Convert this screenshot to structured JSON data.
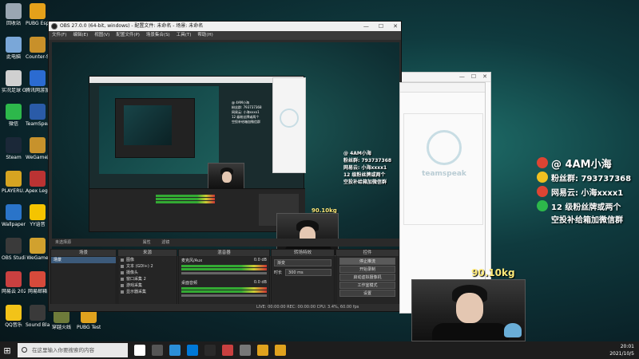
{
  "desktop": {
    "icons": [
      {
        "label": "回收站",
        "color": "#9aa6b2"
      },
      {
        "label": "此电脑",
        "color": "#7aa7d8"
      },
      {
        "label": "实况足球 Online 1",
        "color": "#d0d0d0"
      },
      {
        "label": "微信",
        "color": "#2db84b"
      },
      {
        "label": "Steam",
        "color": "#1b2838"
      },
      {
        "label": "PLAYERU... BATTLEGR...",
        "color": "#d6a421"
      },
      {
        "label": "Wallpaper Engine: ...",
        "color": "#2a74c9"
      },
      {
        "label": "OBS Studio",
        "color": "#3a3a3a"
      },
      {
        "label": "网易云 2021031...",
        "color": "#c94040"
      },
      {
        "label": "QQ音乐",
        "color": "#f2c318"
      },
      {
        "label": "PUBG Esport...",
        "color": "#e5a11a"
      },
      {
        "label": "Counter-S... Global Of...",
        "color": "#c8902a"
      },
      {
        "label": "腾讯网游加速器",
        "color": "#2b6bd1"
      },
      {
        "label": "TeamSpeak 3",
        "color": "#2a5ba8"
      },
      {
        "label": "WeGame版",
        "color": "#c7922c"
      },
      {
        "label": "Apex Legends",
        "color": "#b33"
      },
      {
        "label": "YY语音",
        "color": "#f5c400"
      },
      {
        "label": "WeGame",
        "color": "#d1a12e"
      },
      {
        "label": "网易邮箱",
        "color": "#d64a3b"
      },
      {
        "label": "Sound Blaster ...",
        "color": "#3a3a3a"
      }
    ],
    "second_column_bottom": [
      {
        "label": "穿越火线",
        "color": "#6e7b3a"
      },
      {
        "label": "PUBG Test Server",
        "color": "#e0a21e"
      }
    ]
  },
  "obs_window": {
    "title": "OBS 27.0.0 (64-bit, windows) - 配置文件: 未命名 - 场景: 未命名",
    "menu": [
      "文件(F)",
      "编辑(E)",
      "视图(V)",
      "配置文件(P)",
      "场景集合(S)",
      "工具(T)",
      "帮助(H)"
    ],
    "window_controls": [
      "—",
      "☐",
      "✕"
    ],
    "scenes_title": "场景",
    "scene_item": "场景",
    "sources_title": "来源",
    "sources": [
      "图像",
      "文本 (GDI+) 2",
      "摄像头",
      "窗口采集 2",
      "游戏采集",
      "显示器采集"
    ],
    "mixer_title": "混音器",
    "mixer_tracks": [
      {
        "name": "麦克风/Aux",
        "level": "0.0 dB"
      },
      {
        "name": "桌面音频",
        "level": "0.0 dB"
      }
    ],
    "transitions_title": "转场特效",
    "transition_type": "渐变",
    "transition_duration_label": "时长",
    "transition_duration": "300 ms",
    "controls_title": "控件",
    "controls": [
      "停止推流",
      "开始录制",
      "启动虚拟摄像机",
      "工作室模式",
      "设置",
      "退出"
    ],
    "status": "LIVE: 00:00:00   REC: 00:00:00   CPU: 3.4%, 60.00 fps",
    "panel_header": "未选择源",
    "panel_props": "属性",
    "panel_filters": "滤镜"
  },
  "teamspeak": {
    "logo_text": "teamspeak",
    "window_controls": [
      "—",
      "☐",
      "✕"
    ]
  },
  "social_overlay": {
    "name": "@ 4AM小海",
    "fan_group": "粉丝群: 793737368",
    "netease": "网易云: 小海xxxx1",
    "line1": "12 级粉丝牌或两个",
    "line2": "空投补给箱加微信群"
  },
  "goal_ribbon": {
    "text": "90.10kg"
  },
  "taskbar": {
    "search_placeholder": "在这里输入你要搜索的内容",
    "time": "20:01",
    "date": "2021/10/5",
    "app_colors": [
      "#ffffff",
      "#555555",
      "#2b8fd8",
      "#0078d7",
      "#2a2a2a",
      "#c94040",
      "#777",
      "#e0a21e",
      "#e0a21e"
    ]
  },
  "colors": {
    "desktop_teal": "#1f6f6a",
    "obs_dark": "#2b2b2b",
    "ribbon_yellow": "#ffea7a"
  }
}
